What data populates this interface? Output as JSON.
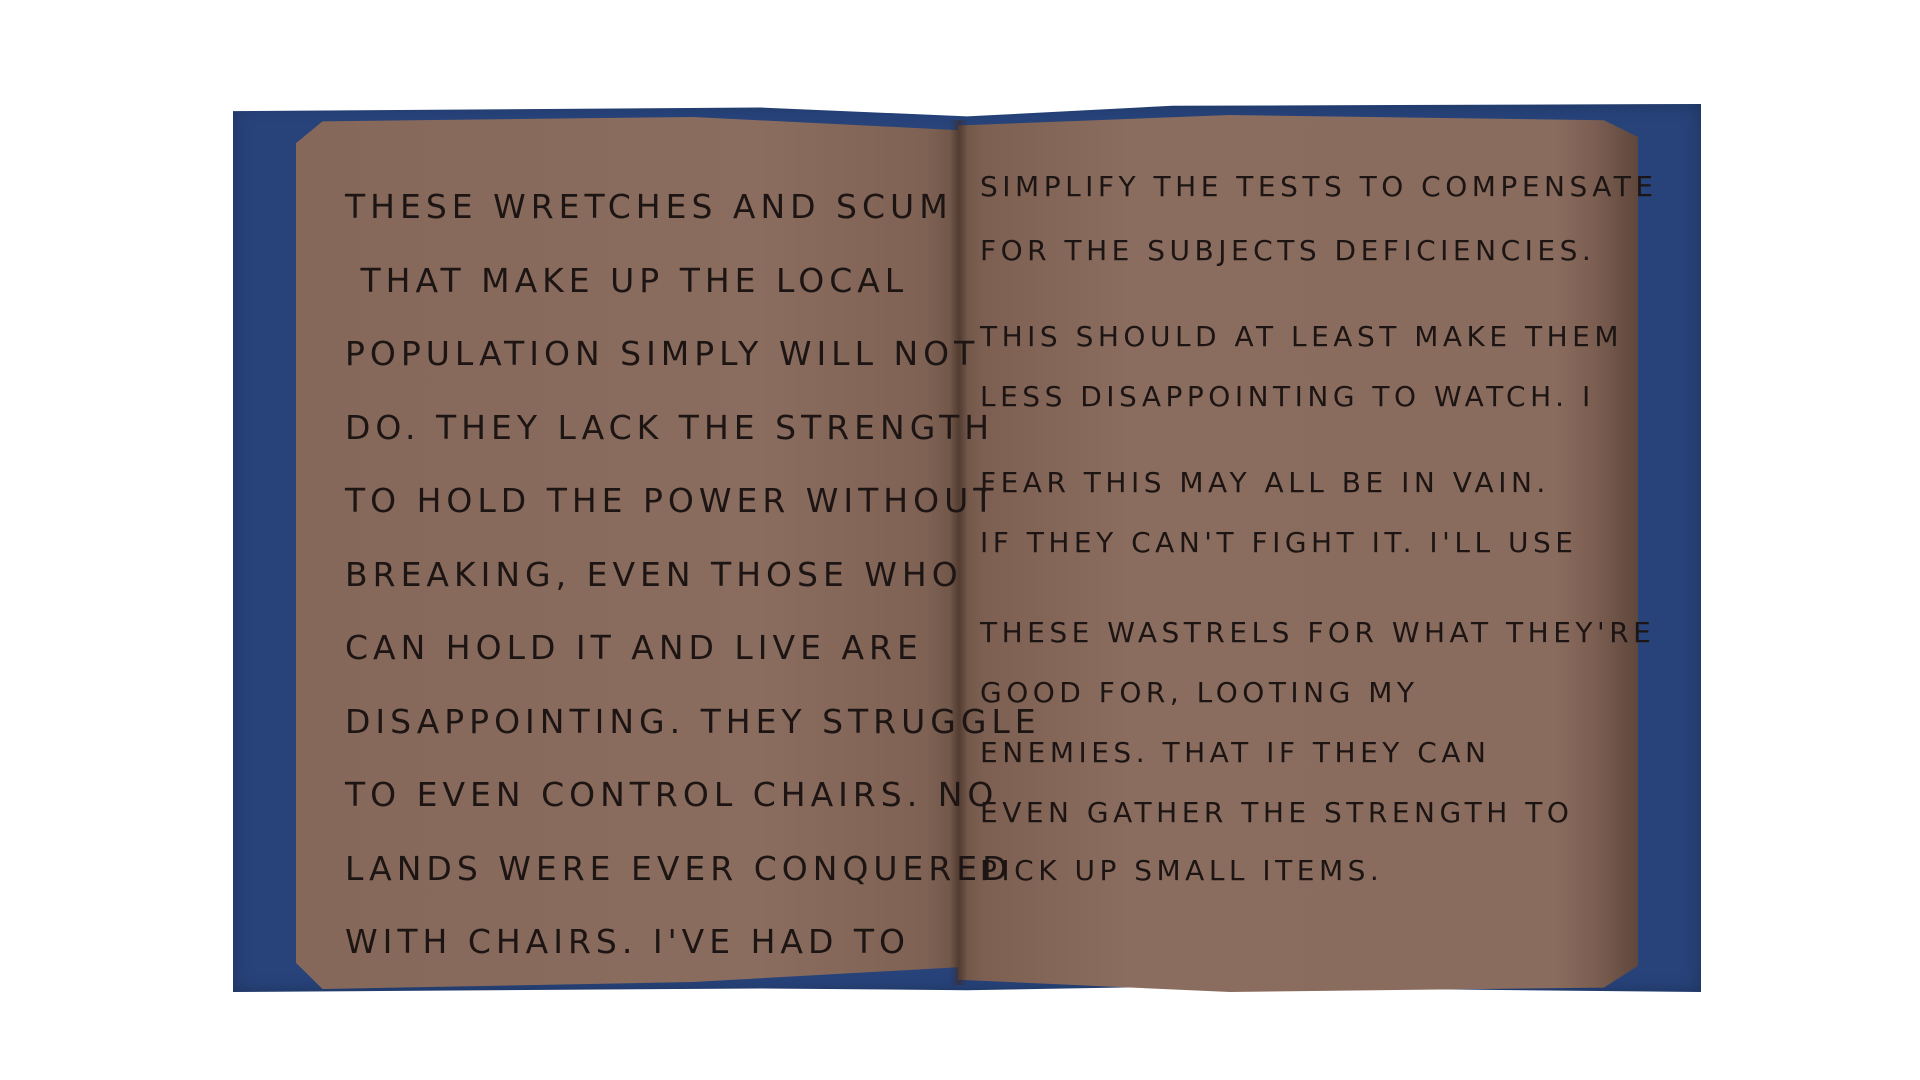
{
  "book": {
    "left_page": {
      "lines": [
        "These wretches and scum",
        " that make up the local",
        "population simply will not",
        "do. They lack the strength",
        "to hold the power without",
        "breaking, even those who",
        "can hold it and live are",
        "disappointing. They struggle",
        "to even control chairs. No",
        "lands were ever conquered",
        "with chairs. I've had to"
      ]
    },
    "right_page": {
      "lines": [
        "simplify the tests to compensate",
        "for the subjects deficiencies.",
        "This should at least make them",
        "less disappointing to watch. I",
        "fear this may all be in vain.",
        "If they can't fight it. I'll use",
        "these wastrels for what they're",
        "good for, looting my",
        "enemies. That if they can",
        "even gather the strength to",
        "pick up small items."
      ]
    },
    "colors": {
      "cover": "#27437a",
      "page": "#8a6b5d",
      "ink": "#1c1514"
    }
  }
}
